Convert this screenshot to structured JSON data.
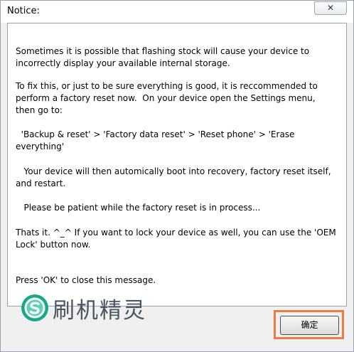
{
  "window": {
    "title": "Notice:",
    "close_label": "✕"
  },
  "message": {
    "p1": "Sometimes it is possible that flashing stock will cause your device to\nincorrectly display your available internal storage.",
    "p2": "To fix this, or just to be sure everything is good, it is reccommended to\nperform a factory reset now.  On your device open the Settings menu,\nthen go to:",
    "p3": "  'Backup & reset' > 'Factory data reset' > 'Reset phone' > 'Erase\neverything'",
    "p4": "   Your device will then automically boot into recovery, factory reset itself,\nand restart.",
    "p5": "   Please be patient while the factory reset is in process...",
    "p6": "Thats it. ^_^ If you want to lock your device as well, you can use the 'OEM\nLock' button now.",
    "p7": "Press 'OK' to close this message."
  },
  "logo": {
    "text": "刷机精灵",
    "icon": "shuaji-jingling-logo-icon",
    "colors": {
      "ring": "#1aa889",
      "ring_light": "#5fd0b6",
      "text": "#4a5561"
    }
  },
  "buttons": {
    "ok_label": "确定",
    "highlight_color": "#ee7b44"
  }
}
